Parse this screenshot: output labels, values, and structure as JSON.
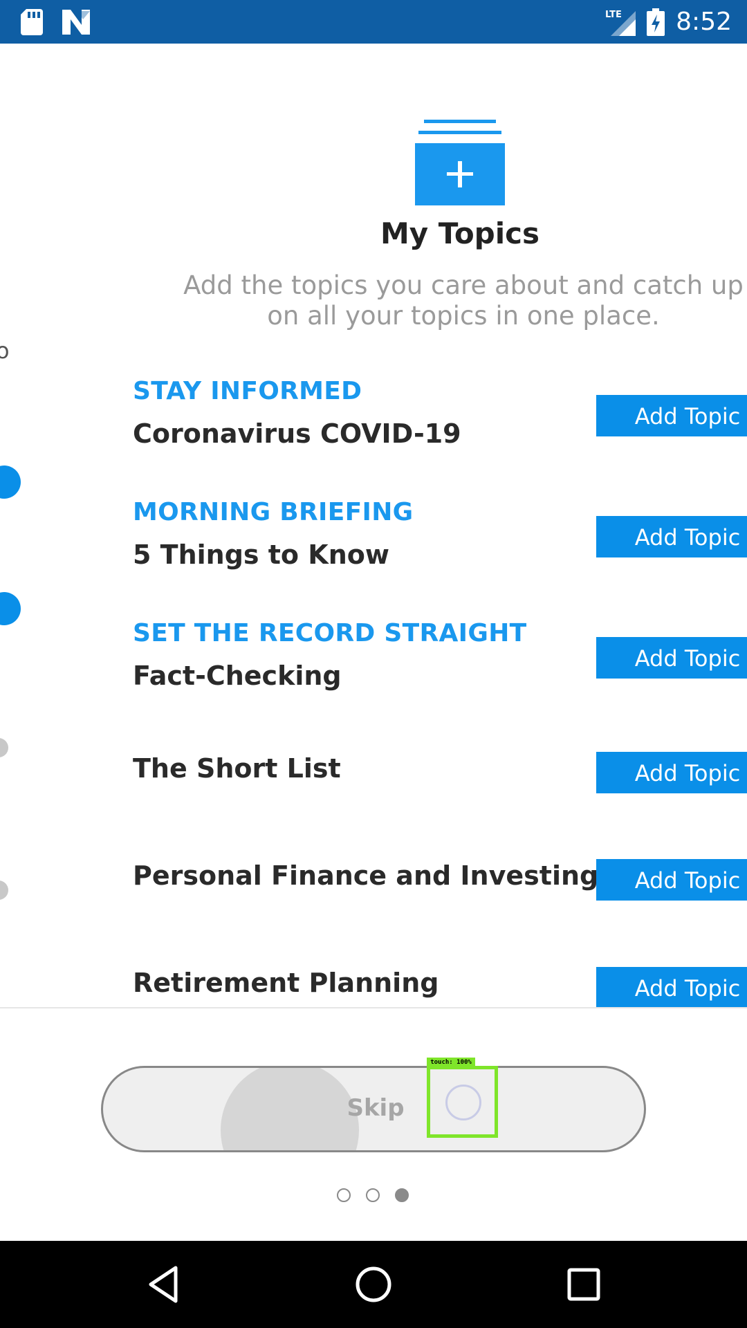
{
  "status_bar": {
    "time": "8:52",
    "network": "LTE",
    "icons": [
      "sd-card-icon",
      "n-app-icon",
      "signal-icon",
      "battery-charging-icon"
    ]
  },
  "hero": {
    "icon": "add-topic-icon",
    "title": "My Topics",
    "description_line1": "Add the topics you care about and catch up",
    "description_line2": "on all your topics in one place."
  },
  "topics": [
    {
      "eyebrow": "STAY INFORMED",
      "name": "Coronavirus COVID-19",
      "button": "Add Topic"
    },
    {
      "eyebrow": "MORNING BRIEFING",
      "name": "5 Things to Know",
      "button": "Add Topic"
    },
    {
      "eyebrow": "SET THE RECORD STRAIGHT",
      "name": "Fact-Checking",
      "button": "Add Topic"
    },
    {
      "eyebrow": "",
      "name": "The Short List",
      "button": "Add Topic"
    },
    {
      "eyebrow": "",
      "name": "Personal Finance and Investing",
      "button": "Add Topic"
    },
    {
      "eyebrow": "",
      "name": "Retirement Planning",
      "button": "Add Topic"
    }
  ],
  "skip": {
    "label": "Skip"
  },
  "touch_overlay": {
    "label": "touch: 100%"
  },
  "pager": {
    "total": 3,
    "active": 3
  },
  "colors": {
    "status_bar": "#0f5ea4",
    "accent_blue": "#1a98ee",
    "button_blue": "#0a8fe8",
    "touch_green": "#7fe52a"
  },
  "nav_bar": {
    "icons": [
      "back-icon",
      "home-icon",
      "recents-icon"
    ]
  }
}
